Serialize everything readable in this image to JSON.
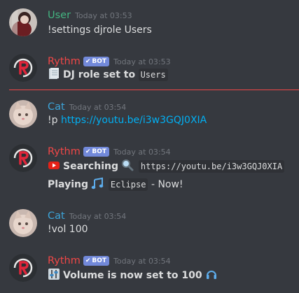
{
  "messages": [
    {
      "author": "User",
      "author_color": "#43b581",
      "timestamp": "Today at 03:53",
      "text": "!settings djrole Users"
    },
    {
      "author": "Rythm",
      "author_color": "#f04747",
      "badge": "BOT",
      "timestamp": "Today at 03:53",
      "emoji": "page-icon",
      "bold_text": "DJ role set to",
      "code": "Users"
    },
    {
      "author": "Cat",
      "author_color": "#3ca4d8",
      "timestamp": "Today at 03:54",
      "prefix": "!p",
      "link": "https://youtu.be/i3w3GQJ0XIA"
    },
    {
      "author": "Rythm",
      "author_color": "#f04747",
      "badge": "BOT",
      "timestamp": "Today at 03:54",
      "line1_emoji": "youtube-icon",
      "line1_bold": "Searching",
      "line1_emoji2": "magnifier-icon",
      "line1_code": "https://youtu.be/i3w3GQJ0XIA",
      "line2_bold": "Playing",
      "line2_emoji": "notes-icon",
      "line2_code": "Eclipse",
      "line2_suffix": "- Now!"
    },
    {
      "author": "Cat",
      "author_color": "#3ca4d8",
      "timestamp": "Today at 03:54",
      "text": "!vol 100"
    },
    {
      "author": "Rythm",
      "author_color": "#f04747",
      "badge": "BOT",
      "timestamp": "Today at 03:54",
      "emoji": "mixer-icon",
      "bold_text": "Volume is now set to 100",
      "emoji2": "headphones-icon"
    }
  ],
  "colors": {
    "background": "#36393f",
    "divider": "#f04747",
    "link": "#00b0f4",
    "bot_badge": "#7289da",
    "text": "#dcddde",
    "timestamp": "#72767d"
  }
}
